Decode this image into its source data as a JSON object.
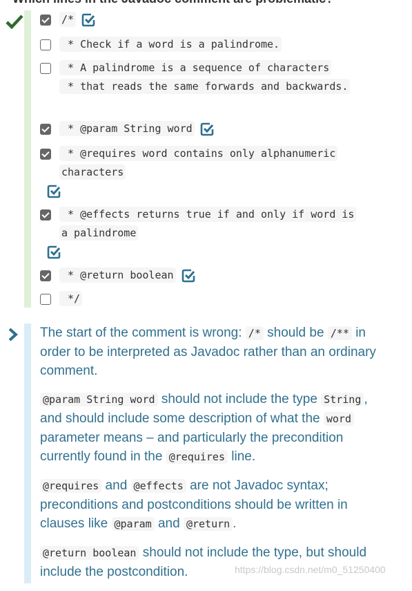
{
  "question": "Which lines in the Javadoc comment are problematic?",
  "result_icon": "checkmark-icon",
  "lines": [
    {
      "text": "/*",
      "checked": true,
      "correct": true
    },
    {
      "text": " * Check if a word is a palindrome.",
      "checked": false,
      "correct": false
    },
    {
      "text": " * A palindrome is a sequence of characters\n * that reads the same forwards and backwards.",
      "checked": false,
      "correct": false
    },
    {
      "text": " * @param String word",
      "checked": true,
      "correct": true
    },
    {
      "text": " * @requires word contains only alphanumeric\ncharacters",
      "checked": true,
      "correct": true
    },
    {
      "text": " * @effects returns true if and only if word is\na palindrome",
      "checked": true,
      "correct": true
    },
    {
      "text": " * @return boolean",
      "checked": true,
      "correct": true
    },
    {
      "text": " */",
      "checked": false,
      "correct": false
    }
  ],
  "feedback": {
    "p1": {
      "a": "The start of the comment is wrong: ",
      "c1": "/*",
      "b": " should be ",
      "c2": "/**",
      "d": " in order to be interpreted as Javadoc rather than an ordinary comment."
    },
    "p2": {
      "c1": "@param String word",
      "a": " should not include the type ",
      "c2": "String",
      "b": ", and should include some description of what the ",
      "c3": "word",
      "d": " parameter means – and particularly the precondition currently found in the ",
      "c4": "@requires",
      "e": " line."
    },
    "p3": {
      "c1": "@requires",
      "a": " and ",
      "c2": "@effects",
      "b": " are not Javadoc syntax; preconditions and postconditions should be written in clauses like ",
      "c3": "@param",
      "d": " and ",
      "c4": "@return",
      "e": "."
    },
    "p4": {
      "c1": "@return boolean",
      "a": " should not include the type, but should include the postcondition."
    }
  },
  "watermark": "https://blog.csdn.net/m0_51250400",
  "colors": {
    "correct": "#2e6b2e",
    "feedback": "#31708f",
    "ok_icon": "#2f6f8f"
  }
}
